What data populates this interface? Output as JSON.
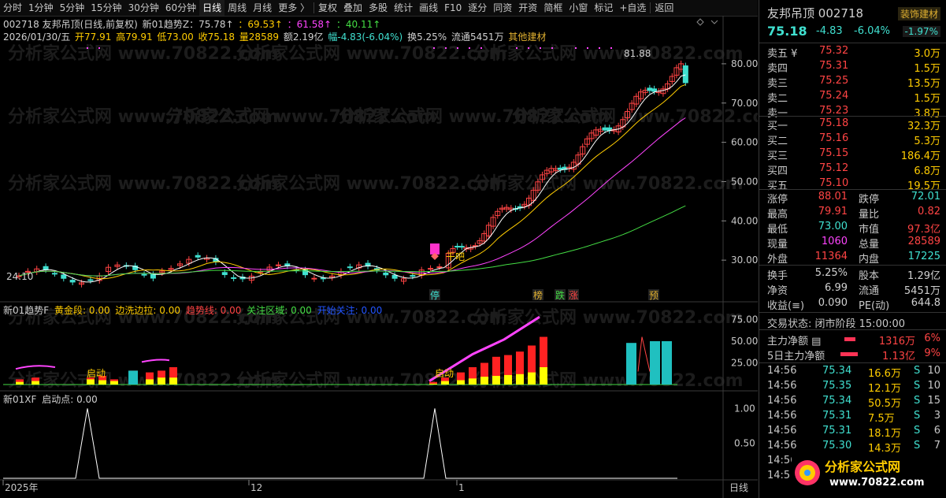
{
  "toolbar": {
    "items": [
      "分时",
      "1分钟",
      "5分钟",
      "15分钟",
      "30分钟",
      "60分钟",
      "日线",
      "周线",
      "月线",
      "更多 〉",
      "复权",
      "叠加",
      "多股",
      "统计",
      "画线",
      "F10",
      "逐分",
      "同资",
      "开资",
      "简框",
      "小窗",
      "标记",
      "+自选",
      "返回"
    ],
    "active": "日线"
  },
  "info": {
    "stock": "002718 友邦吊顶(日线,前复权)",
    "indicator": "新01趋势Z：75.78↑",
    "ma2": "：69.53↑",
    "ma3": "：61.58↑",
    "ma4": "：40.11↑",
    "date": "2026/01/30/五",
    "open": "开77.91",
    "high": "高79.91",
    "low": "低73.00",
    "close": "收75.18",
    "volume": "量28589",
    "amount": "额2.19亿",
    "range": "幅-4.83(-6.04%)",
    "turnover": "换5.25%",
    "float": "流通5451万",
    "sector": "其他建材"
  },
  "main_axis": {
    "ticks": [
      "80.00",
      "70.00",
      "60.00",
      "50.00",
      "40.00",
      "30.00"
    ]
  },
  "annotations": {
    "high_label": "81.88",
    "low_label": "24.10",
    "signal": "干吧",
    "markers": [
      "停",
      "榜",
      "跌",
      "涨",
      "预"
    ]
  },
  "sub1": {
    "name": "新01趋势F",
    "fields": [
      "黄金段: 0.00",
      "边洗边拉: 0.00",
      "趋势线: 0.00",
      "关注区域: 0.00",
      "开始关注: 0.00"
    ],
    "ticks": [
      "75.00",
      "50.00",
      "25.00"
    ],
    "labels": [
      "启动",
      "启动"
    ]
  },
  "sub2": {
    "name": "新01XF",
    "field": "启动点: 0.00",
    "ticks": [
      "1.00",
      "0.50"
    ]
  },
  "xaxis": {
    "labels": [
      "2025年",
      "12",
      "1"
    ],
    "period": "日线"
  },
  "watermark": "分析家公式网  www.70822.com",
  "panel": {
    "name": "友邦吊顶",
    "code": "002718",
    "tag": "装饰建材",
    "price": "75.18",
    "change": "-4.83",
    "pct": "-6.04%",
    "pct2": "-1.97%",
    "asks": [
      {
        "name": "卖五 ¥",
        "price": "75.32",
        "vol": "3.0万"
      },
      {
        "name": "卖四",
        "price": "75.31",
        "vol": "1.5万"
      },
      {
        "name": "卖三",
        "price": "75.25",
        "vol": "13.5万"
      },
      {
        "name": "卖二",
        "price": "75.24",
        "vol": "1.5万"
      },
      {
        "name": "卖一",
        "price": "75.23",
        "vol": "3.8万"
      }
    ],
    "bids": [
      {
        "name": "买一",
        "price": "75.18",
        "vol": "32.3万"
      },
      {
        "name": "买二",
        "price": "75.16",
        "vol": "5.3万"
      },
      {
        "name": "买三",
        "price": "75.15",
        "vol": "186.4万"
      },
      {
        "name": "买四",
        "price": "75.12",
        "vol": "6.8万"
      },
      {
        "name": "买五",
        "price": "75.10",
        "vol": "19.5万"
      }
    ],
    "stats": [
      [
        "涨停",
        "88.01",
        "跌停",
        "72.01"
      ],
      [
        "最高",
        "79.91",
        "量比",
        "0.82"
      ],
      [
        "最低",
        "73.00",
        "市值",
        "97.3亿"
      ],
      [
        "现量",
        "1060",
        "总量",
        "28589"
      ],
      [
        "外盘",
        "11364",
        "内盘",
        "17225"
      ]
    ],
    "stats2": [
      [
        "换手",
        "5.25%",
        "股本",
        "1.29亿"
      ],
      [
        "净资",
        "6.99",
        "流通",
        "5451万"
      ],
      [
        "收益(≡)",
        "0.090",
        "PE(动)",
        "644.8"
      ]
    ],
    "status": "交易状态: 闭市阶段 15:00:00",
    "flow1": {
      "label": "主力净额 ▤",
      "value": "1316万",
      "pct": "6%"
    },
    "flow2": {
      "label": "5日主力净额",
      "value": "1.13亿",
      "pct": "9%"
    },
    "ticks": [
      [
        "14:56",
        "75.34",
        "16.6万",
        "S",
        "10"
      ],
      [
        "14:56",
        "75.35",
        "12.1万",
        "S",
        "10"
      ],
      [
        "14:56",
        "75.34",
        "50.5万",
        "S",
        "15"
      ],
      [
        "14:56",
        "75.31",
        "7.5万",
        "S",
        "3"
      ],
      [
        "14:56",
        "75.31",
        "18.1万",
        "S",
        "6"
      ],
      [
        "14:56",
        "75.30",
        "14.3万",
        "S",
        "7"
      ],
      [
        "14:56",
        "",
        "",
        "",
        ""
      ],
      [
        "14:5",
        "",
        "",
        "",
        ""
      ]
    ],
    "logo_text": "分析家公式网",
    "logo_url": "www.70822.com"
  },
  "chart_data": {
    "type": "candlestick",
    "ylim": [
      20,
      85
    ],
    "high_label": 81.88,
    "low_label": 24.1
  },
  "colors": {
    "up": "#ff4444",
    "down": "#40e0d0",
    "ma1": "#ffffff",
    "ma2": "#ffcc00",
    "ma3": "#ff44ff",
    "ma4": "#44dd44"
  }
}
